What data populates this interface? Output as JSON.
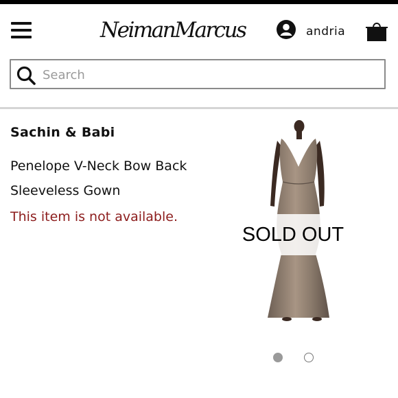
{
  "header": {
    "logo_text": "NeimanMarcus",
    "account_name": "andria",
    "icons": [
      "menu-icon",
      "user-icon",
      "shopping-bag-icon",
      "search-icon"
    ]
  },
  "search": {
    "placeholder": "Search",
    "value": ""
  },
  "product": {
    "brand": "Sachin & Babi",
    "name_line_1": "Penelope V-Neck Bow Back",
    "name_line_2": "Sleeveless Gown",
    "availability": "This item is not available.",
    "sold_out_label": "SOLD OUT",
    "gallery_count": 2,
    "gallery_active": 1
  },
  "colors": {
    "availability_text": "#8c1c1c",
    "gown": "#8b7b6c",
    "active_dot": "#9a9a9a"
  }
}
